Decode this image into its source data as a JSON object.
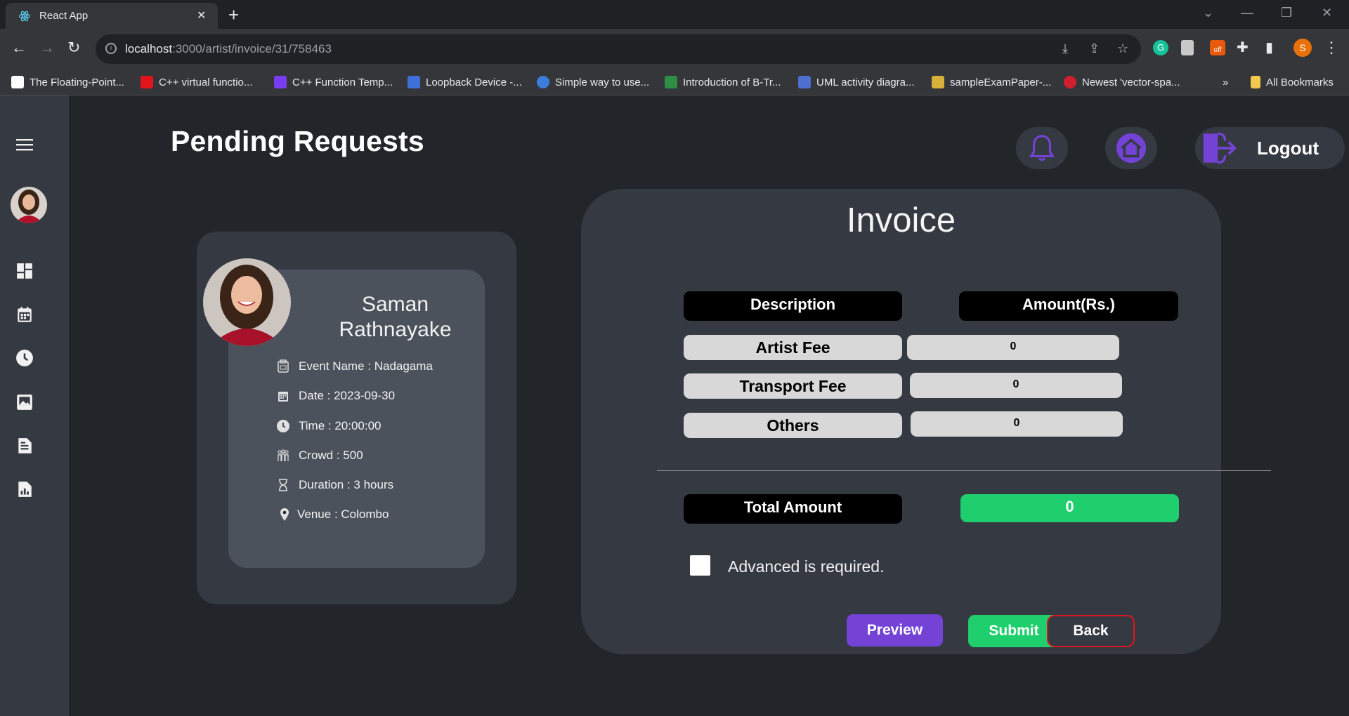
{
  "browser": {
    "tab_title": "React App",
    "tab_close": "✕",
    "new_tab": "+",
    "url_host": "localhost",
    "url_path": ":3000/artist/invoice/31/758463",
    "profile_initial": "S",
    "ext_badge": "off",
    "bookmarks": [
      {
        "label": "The Floating-Point...",
        "color": "#ffffff"
      },
      {
        "label": "C++ virtual functio...",
        "color": "#e0141a"
      },
      {
        "label": "C++ Function Temp...",
        "color": "#7a3cf0"
      },
      {
        "label": "Loopback Device -...",
        "color": "#3f6fd8"
      },
      {
        "label": "Simple way to use...",
        "color": "#3b7dd8"
      },
      {
        "label": "Introduction of B-Tr...",
        "color": "#2f8d46"
      },
      {
        "label": "UML activity diagra...",
        "color": "#4f6fd0"
      },
      {
        "label": "sampleExamPaper-...",
        "color": "#d8b13b"
      },
      {
        "label": "Newest 'vector-spa...",
        "color": "#d02030"
      }
    ],
    "bookmarks_more": "»",
    "all_bookmarks": "All Bookmarks"
  },
  "header": {
    "title": "Pending Requests",
    "logout_label": "Logout"
  },
  "artist": {
    "name": "Saman Rathnayake",
    "details": {
      "event": "Event Name : Nadagama",
      "date": "Date : 2023-09-30",
      "time": "Time : 20:00:00",
      "crowd": "Crowd : 500",
      "duration": "Duration : 3 hours",
      "venue": "Venue : Colombo"
    }
  },
  "invoice": {
    "title": "Invoice",
    "col_description": "Description",
    "col_amount": "Amount(Rs.)",
    "rows": [
      {
        "label": "Artist Fee",
        "value": "0"
      },
      {
        "label": "Transport Fee",
        "value": "0"
      },
      {
        "label": "Others",
        "value": "0"
      }
    ],
    "total_label": "Total Amount",
    "total_value": "0",
    "advance_label": "Advanced is required.",
    "buttons": {
      "preview": "Preview",
      "submit": "Submit",
      "back": "Back"
    }
  },
  "colors": {
    "accent_purple": "#7443d6",
    "success_green": "#1fce6d",
    "focus_red": "#e0141a"
  }
}
